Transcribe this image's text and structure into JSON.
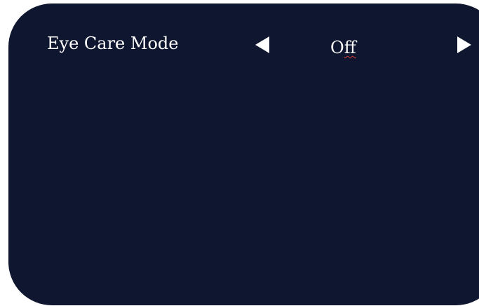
{
  "setting": {
    "label": "Eye Care Mode",
    "value_prefix": "O",
    "value_rest": "ff"
  },
  "icons": {
    "previous": "triangle-left-icon",
    "next": "triangle-right-icon"
  },
  "colors": {
    "panel_background": "#0f162f",
    "text": "#ffffff",
    "spellcheck_underline": "#d23a3a"
  }
}
